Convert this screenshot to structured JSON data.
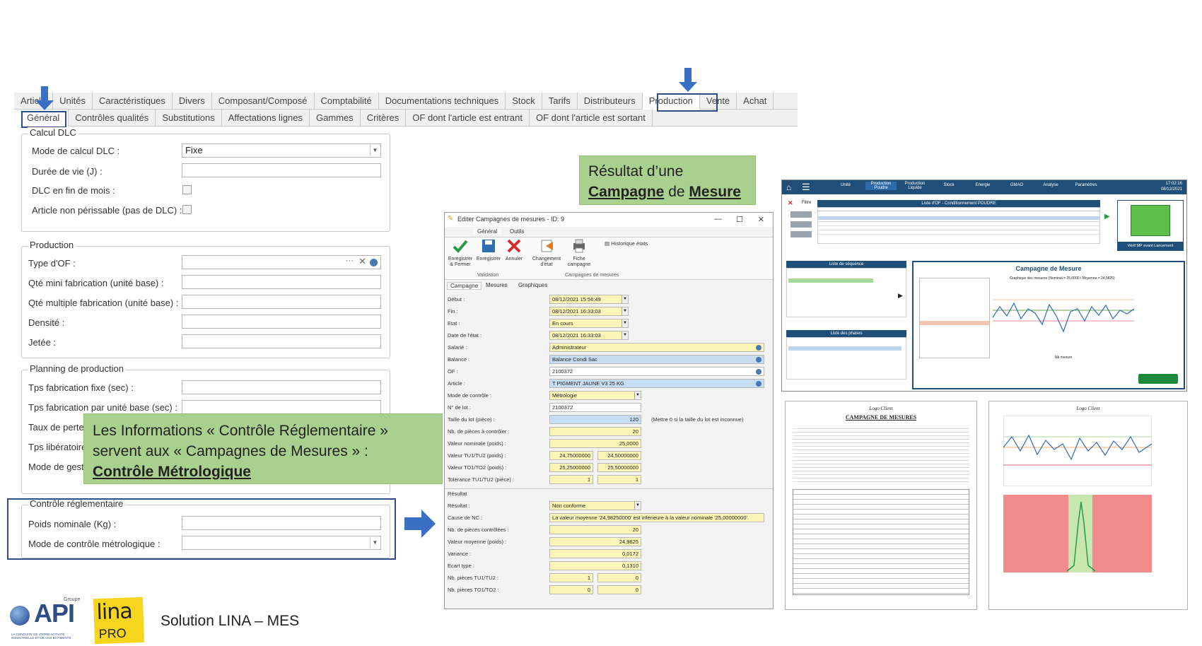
{
  "form": {
    "tabs_row1": [
      "Article",
      "Unités",
      "Caractéristiques",
      "Divers",
      "Composant/Composé",
      "Comptabilité",
      "Documentations techniques",
      "Stock",
      "Tarifs",
      "Distributeurs",
      "Production",
      "Vente",
      "Achat"
    ],
    "tabs_row2": [
      "Général",
      "Contrôles qualités",
      "Substitutions",
      "Affectations lignes",
      "Gammes",
      "Critères",
      "OF dont l'article est entrant",
      "OF dont l'article est sortant"
    ],
    "dlc": {
      "legend": "Calcul DLC",
      "mode_label": "Mode de calcul DLC :",
      "mode_value": "Fixe",
      "duree_label": "Durée de vie (J) :",
      "fin_mois_label": "DLC en fin de mois :",
      "non_perissable_label": "Article non périssable (pas de DLC) :"
    },
    "production": {
      "legend": "Production",
      "type_of_label": "Type d'OF :",
      "qte_mini_label": "Qté mini fabrication (unité base) :",
      "qte_multiple_label": "Qté multiple fabrication (unité base) :",
      "densite_label": "Densité :",
      "jetee_label": "Jetée :"
    },
    "planning": {
      "legend": "Planning de production",
      "tps_fixe_label": "Tps fabrication fixe (sec) :",
      "tps_unite_label": "Tps fabrication par unité base (sec) :",
      "taux_perte_label": "Taux de perte",
      "tps_liberatoire_label": "Tps libératoire",
      "mode_gestion_label": "Mode de gesti"
    },
    "reglementaire": {
      "legend": "Contrôle réglementaire",
      "poids_label": "Poids nominale (Kg) :",
      "mode_controle_label": "Mode de contrôle métrologique :"
    }
  },
  "callouts": {
    "result_line1": "Résultat d’une",
    "result_campagne": "Campagne",
    "result_de": " de ",
    "result_mesure": "Mesure",
    "info_line1": "Les Informations « Contrôle Réglementaire »",
    "info_line2": "servent aux « Campagnes de Mesures » :",
    "info_line3": "Contrôle Métrologique"
  },
  "dialog": {
    "title": "Editer Campagnes de mesures - ID: 9",
    "ribbon_tabs": [
      "Général",
      "Outils"
    ],
    "buttons": [
      "Enregistrer & Fermer",
      "Enregistrer",
      "Annuler",
      "Changement d'état",
      "Fiche campagne"
    ],
    "historique": "Historique états",
    "group_validation": "Validation",
    "group_campagnes": "Campagnes de mesures",
    "sub_tabs": [
      "Campagne",
      "Mesures",
      "Graphiques"
    ],
    "debut_label": "Début :",
    "debut_value": "08/12/2021 15:56:49",
    "fin_label": "Fin :",
    "fin_value": "08/12/2021 16:33:03",
    "etat_label": "Etat :",
    "etat_value": "En cours",
    "date_etat_label": "Date de l'état :",
    "date_etat_value": "08/12/2021 16:33:03",
    "salarie_label": "Salarié :",
    "salarie_value": "Administrateur",
    "balance_label": "Balance :",
    "balance_value": "Balance Condi Sac",
    "of_label": "OF :",
    "of_value": "2100372",
    "article_label": "Article :",
    "article_value": "T PIGMENT JAUNE V3 25 KG",
    "mode_label": "Mode de contrôle :",
    "mode_value": "Métrologie",
    "lot_label": "N° de lot :",
    "lot_value": "2100372",
    "taille_label": "Taille du lot (pièce) :",
    "taille_value": "120",
    "taille_note": "(Mettre 0 si la taille du lot est inconnue)",
    "nb_controler_label": "Nb. de pièces à contrôler :",
    "nb_controler_value": "20",
    "nominale_label": "Valeur nominale (poids) :",
    "nominale_value": "25,0000",
    "tu1_label": "Valeur TU1/TU2 (poids) :",
    "tu1_value1": "24,75000000",
    "tu1_value2": "24,50000000",
    "to1_label": "Valeur TO1/TO2 (poids) :",
    "to1_value1": "25,25000000",
    "to1_value2": "25,50000000",
    "tol_label": "Tolérance TU1/TU2 (pièce) :",
    "tol_value1": "1",
    "tol_value2": "1",
    "resultat_section": "Résultat",
    "resultat_label": "Résultat :",
    "resultat_value": "Non conforme",
    "cause_label": "Cause de NC :",
    "cause_value": "La valeur moyenne '24,98250000' est inférieure à la valeur nominale '25,00000000'.",
    "nb_controlees_label": "Nb. de pièces contrôlées :",
    "nb_controlees_value": "20",
    "moyenne_label": "Valeur moyenne (poids) :",
    "moyenne_value": "24,9825",
    "variance_label": "Variance :",
    "variance_value": "0,0172",
    "ecart_label": "Ecart type :",
    "ecart_value": "0,1310",
    "nb_tu_label": "Nb. pièces TU1/TU2 :",
    "nb_tu_value1": "1",
    "nb_tu_value2": "0",
    "nb_to_label": "Nb. pièces TO1/TO2 :",
    "nb_to_value1": "0",
    "nb_to_value2": "0"
  },
  "mes": {
    "nav": [
      "Unité",
      "Production Poudre",
      "Production Liquide",
      "Stock",
      "Energie",
      "GMAO",
      "Analyse",
      "Paramètres"
    ],
    "time": "17:02:16",
    "date": "08/12/2021",
    "of_list_title": "Liste d'OF - Conditionnement POUDRE",
    "filter": "Filtre",
    "sequence_title": "Liste de séquence",
    "phases_title": "Liste des phases",
    "campagne_title": "Campagne de Mesure",
    "chart_caption": "Graphique des mesures (Nominal = 25,0000 / Moyenne = 24,9825)",
    "x_label": "Nb mesure",
    "launch_label": "Vérif MP avant Lancement"
  },
  "reports": {
    "logo_client": "Logo Client",
    "report_title": "CAMPAGNE DE MESURES"
  },
  "footer": {
    "groupe": "Groupe",
    "api": "API",
    "api_tag": "LA CONDUITE DE VOTRE ACTIVITÉ INDUSTRIELLE ET DE VOS BÂTIMENTS",
    "lina": "lina",
    "pro": "PRO",
    "solution": "Solution LINA – MES"
  },
  "colors": {
    "highlight_blue": "#2f4d86",
    "arrow_blue": "#3b6fc4",
    "callout_green": "#a9d08e",
    "mes_navy": "#1f4e79"
  }
}
